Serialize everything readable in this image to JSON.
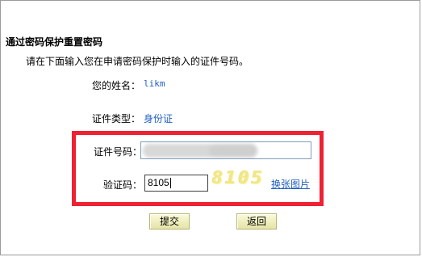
{
  "page": {
    "title": "通过密码保护重置密码",
    "instruction": "请在下面输入您在申请密码保护时输入的证件号码。"
  },
  "form": {
    "name_label": "您的姓名：",
    "name_value": "likm",
    "id_type_label": "证件类型：",
    "id_type_value": "身份证",
    "id_number_label": "证件号码：",
    "id_number_value": "",
    "captcha_label": "验证码：",
    "captcha_value": "8105",
    "captcha_image_text": "8105",
    "captcha_refresh_label": "换张图片"
  },
  "buttons": {
    "submit_label": "提交",
    "back_label": "返回"
  },
  "colors": {
    "highlight": "#ee2233",
    "link": "#1f5fbf",
    "button_bg": "#f4f2c0"
  },
  "icons": {
    "id_input_state": "blurred-redacted"
  }
}
